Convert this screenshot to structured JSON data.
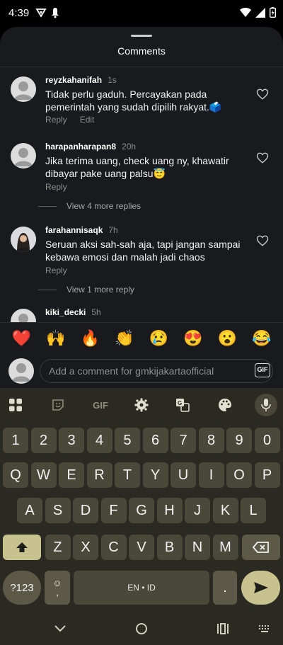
{
  "status": {
    "time": "4:39"
  },
  "sheet": {
    "title": "Comments"
  },
  "comments": [
    {
      "user": "reyzkahanifah",
      "time": "1s",
      "text": "Tidak perlu gaduh. Percayakan pada pemerintah yang sudah dipilih rakyat.🗳️",
      "reply": "Reply",
      "edit": "Edit"
    },
    {
      "user": "harapanharapan8",
      "time": "20h",
      "text": "Jika terima uang, check uang ny, khawatir dibayar pake uang palsu😇",
      "reply": "Reply",
      "more_replies": "View 4 more replies"
    },
    {
      "user": "farahannisaqk",
      "time": "7h",
      "text": "Seruan aksi sah-sah aja, tapi jangan sampai kebawa emosi dan malah jadi chaos",
      "reply": "Reply",
      "more_replies": "View 1 more reply"
    },
    {
      "user": "kiki_decki",
      "time": "5h"
    }
  ],
  "emojis": [
    "❤️",
    "🙌",
    "🔥",
    "👏",
    "😢",
    "😍",
    "😮",
    "😂"
  ],
  "composer": {
    "placeholder": "Add a comment for gmkijakartaofficial",
    "gif": "GIF"
  },
  "keyboard": {
    "toolbar_gif": "GIF",
    "row1": [
      "1",
      "2",
      "3",
      "4",
      "5",
      "6",
      "7",
      "8",
      "9",
      "0"
    ],
    "row2": [
      "Q",
      "W",
      "E",
      "R",
      "T",
      "Y",
      "U",
      "I",
      "O",
      "P"
    ],
    "row3": [
      "A",
      "S",
      "D",
      "F",
      "G",
      "H",
      "J",
      "K",
      "L"
    ],
    "row4": [
      "Z",
      "X",
      "C",
      "V",
      "B",
      "N",
      "M"
    ],
    "symbols": "?123",
    "emoji_key_top": "☺",
    "emoji_key_bottom": ",",
    "space": "EN • ID",
    "period": "."
  },
  "colors": {
    "sheet_bg": "#181a1d",
    "keyboard_bg": "#2b2a22",
    "key_bg": "#4a4839",
    "accent_key": "#c7c28e"
  }
}
